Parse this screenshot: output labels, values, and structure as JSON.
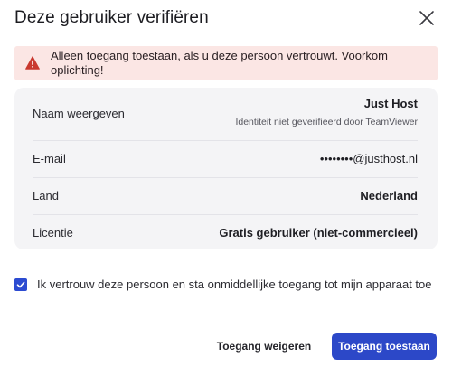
{
  "dialog": {
    "title": "Deze gebruiker verifiëren"
  },
  "alert": {
    "icon": "warning-triangle-icon",
    "text": "Alleen toegang toestaan, als u deze persoon vertrouwt. Voorkom oplichting!",
    "color": "#c9392f",
    "background": "#fbe6e4"
  },
  "details": {
    "display_name": {
      "label": "Naam weergeven",
      "value": "Just Host",
      "note": "Identiteit niet geverifieerd door TeamViewer"
    },
    "email": {
      "label": "E-mail",
      "value": "••••••••@justhost.nl"
    },
    "country": {
      "label": "Land",
      "value": "Nederland"
    },
    "license": {
      "label": "Licentie",
      "value": "Gratis gebruiker (niet-commercieel)"
    }
  },
  "consent": {
    "checked": true,
    "text": "Ik vertrouw deze persoon en sta onmiddellijke toegang tot mijn apparaat toe"
  },
  "footer": {
    "decline_label": "Toegang weigeren",
    "allow_label": "Toegang toestaan"
  },
  "colors": {
    "primary": "#2c48c8",
    "panel": "#f4f4f6"
  }
}
